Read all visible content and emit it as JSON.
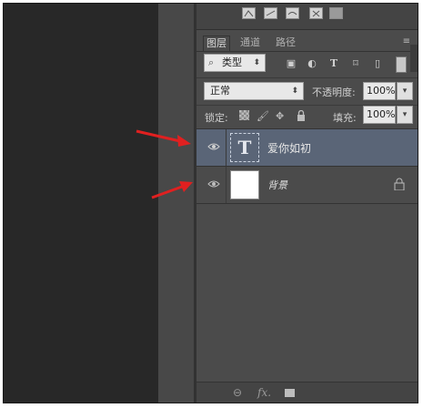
{
  "panel": {
    "tabs": [
      {
        "label": "图层",
        "active": true
      },
      {
        "label": "通道",
        "active": false
      },
      {
        "label": "路径",
        "active": false
      }
    ],
    "menu_icon": "≡",
    "filter": {
      "kind_value": "类型",
      "search_glyph": "⌕",
      "icons": [
        "image-filter-icon",
        "adjustment-filter-icon",
        "text-filter-icon",
        "shape-filter-icon",
        "smart-object-filter-icon"
      ]
    },
    "blend": {
      "mode": "正常",
      "opacity_label": "不透明度:",
      "opacity_value": "100%"
    },
    "lock": {
      "label": "锁定:",
      "fill_label": "填充:",
      "fill_value": "100%"
    },
    "layers": [
      {
        "name": "爱你如初",
        "type": "text",
        "thumb_glyph": "T",
        "visible": true,
        "selected": true,
        "locked": false
      },
      {
        "name": "背景",
        "type": "background",
        "visible": true,
        "selected": false,
        "locked": true
      }
    ],
    "bottom_icons": [
      "link-icon",
      "fx-icon",
      "mask-icon"
    ],
    "fx_label": "fx."
  },
  "colors": {
    "accent_selected": "#5a6577",
    "panel_bg": "#4b4b4b",
    "annotation_arrow": "#e02020"
  }
}
